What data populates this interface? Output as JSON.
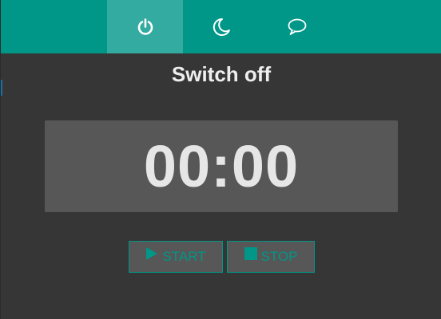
{
  "nav": {
    "tabs": [
      {
        "name": "power",
        "icon": "power-icon",
        "active": true
      },
      {
        "name": "sleep",
        "icon": "moon-icon",
        "active": false
      },
      {
        "name": "messages",
        "icon": "chat-bubble-icon",
        "active": false
      }
    ]
  },
  "page": {
    "title": "Switch off"
  },
  "timer": {
    "display": "00:00"
  },
  "controls": {
    "start_label": "START",
    "stop_label": "STOP"
  },
  "colors": {
    "accent": "#009688",
    "background": "#363636",
    "panel": "#575757",
    "text": "#eeeeee"
  }
}
